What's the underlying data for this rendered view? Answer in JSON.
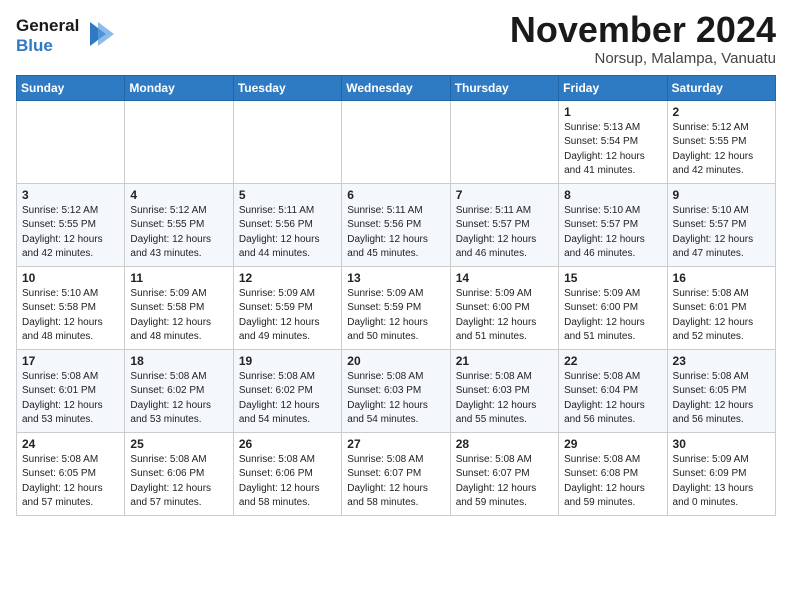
{
  "header": {
    "logo_line1": "General",
    "logo_line2": "Blue",
    "month": "November 2024",
    "location": "Norsup, Malampa, Vanuatu"
  },
  "weekdays": [
    "Sunday",
    "Monday",
    "Tuesday",
    "Wednesday",
    "Thursday",
    "Friday",
    "Saturday"
  ],
  "weeks": [
    [
      {
        "day": "",
        "info": ""
      },
      {
        "day": "",
        "info": ""
      },
      {
        "day": "",
        "info": ""
      },
      {
        "day": "",
        "info": ""
      },
      {
        "day": "",
        "info": ""
      },
      {
        "day": "1",
        "info": "Sunrise: 5:13 AM\nSunset: 5:54 PM\nDaylight: 12 hours\nand 41 minutes."
      },
      {
        "day": "2",
        "info": "Sunrise: 5:12 AM\nSunset: 5:55 PM\nDaylight: 12 hours\nand 42 minutes."
      }
    ],
    [
      {
        "day": "3",
        "info": "Sunrise: 5:12 AM\nSunset: 5:55 PM\nDaylight: 12 hours\nand 42 minutes."
      },
      {
        "day": "4",
        "info": "Sunrise: 5:12 AM\nSunset: 5:55 PM\nDaylight: 12 hours\nand 43 minutes."
      },
      {
        "day": "5",
        "info": "Sunrise: 5:11 AM\nSunset: 5:56 PM\nDaylight: 12 hours\nand 44 minutes."
      },
      {
        "day": "6",
        "info": "Sunrise: 5:11 AM\nSunset: 5:56 PM\nDaylight: 12 hours\nand 45 minutes."
      },
      {
        "day": "7",
        "info": "Sunrise: 5:11 AM\nSunset: 5:57 PM\nDaylight: 12 hours\nand 46 minutes."
      },
      {
        "day": "8",
        "info": "Sunrise: 5:10 AM\nSunset: 5:57 PM\nDaylight: 12 hours\nand 46 minutes."
      },
      {
        "day": "9",
        "info": "Sunrise: 5:10 AM\nSunset: 5:57 PM\nDaylight: 12 hours\nand 47 minutes."
      }
    ],
    [
      {
        "day": "10",
        "info": "Sunrise: 5:10 AM\nSunset: 5:58 PM\nDaylight: 12 hours\nand 48 minutes."
      },
      {
        "day": "11",
        "info": "Sunrise: 5:09 AM\nSunset: 5:58 PM\nDaylight: 12 hours\nand 48 minutes."
      },
      {
        "day": "12",
        "info": "Sunrise: 5:09 AM\nSunset: 5:59 PM\nDaylight: 12 hours\nand 49 minutes."
      },
      {
        "day": "13",
        "info": "Sunrise: 5:09 AM\nSunset: 5:59 PM\nDaylight: 12 hours\nand 50 minutes."
      },
      {
        "day": "14",
        "info": "Sunrise: 5:09 AM\nSunset: 6:00 PM\nDaylight: 12 hours\nand 51 minutes."
      },
      {
        "day": "15",
        "info": "Sunrise: 5:09 AM\nSunset: 6:00 PM\nDaylight: 12 hours\nand 51 minutes."
      },
      {
        "day": "16",
        "info": "Sunrise: 5:08 AM\nSunset: 6:01 PM\nDaylight: 12 hours\nand 52 minutes."
      }
    ],
    [
      {
        "day": "17",
        "info": "Sunrise: 5:08 AM\nSunset: 6:01 PM\nDaylight: 12 hours\nand 53 minutes."
      },
      {
        "day": "18",
        "info": "Sunrise: 5:08 AM\nSunset: 6:02 PM\nDaylight: 12 hours\nand 53 minutes."
      },
      {
        "day": "19",
        "info": "Sunrise: 5:08 AM\nSunset: 6:02 PM\nDaylight: 12 hours\nand 54 minutes."
      },
      {
        "day": "20",
        "info": "Sunrise: 5:08 AM\nSunset: 6:03 PM\nDaylight: 12 hours\nand 54 minutes."
      },
      {
        "day": "21",
        "info": "Sunrise: 5:08 AM\nSunset: 6:03 PM\nDaylight: 12 hours\nand 55 minutes."
      },
      {
        "day": "22",
        "info": "Sunrise: 5:08 AM\nSunset: 6:04 PM\nDaylight: 12 hours\nand 56 minutes."
      },
      {
        "day": "23",
        "info": "Sunrise: 5:08 AM\nSunset: 6:05 PM\nDaylight: 12 hours\nand 56 minutes."
      }
    ],
    [
      {
        "day": "24",
        "info": "Sunrise: 5:08 AM\nSunset: 6:05 PM\nDaylight: 12 hours\nand 57 minutes."
      },
      {
        "day": "25",
        "info": "Sunrise: 5:08 AM\nSunset: 6:06 PM\nDaylight: 12 hours\nand 57 minutes."
      },
      {
        "day": "26",
        "info": "Sunrise: 5:08 AM\nSunset: 6:06 PM\nDaylight: 12 hours\nand 58 minutes."
      },
      {
        "day": "27",
        "info": "Sunrise: 5:08 AM\nSunset: 6:07 PM\nDaylight: 12 hours\nand 58 minutes."
      },
      {
        "day": "28",
        "info": "Sunrise: 5:08 AM\nSunset: 6:07 PM\nDaylight: 12 hours\nand 59 minutes."
      },
      {
        "day": "29",
        "info": "Sunrise: 5:08 AM\nSunset: 6:08 PM\nDaylight: 12 hours\nand 59 minutes."
      },
      {
        "day": "30",
        "info": "Sunrise: 5:09 AM\nSunset: 6:09 PM\nDaylight: 13 hours\nand 0 minutes."
      }
    ]
  ]
}
